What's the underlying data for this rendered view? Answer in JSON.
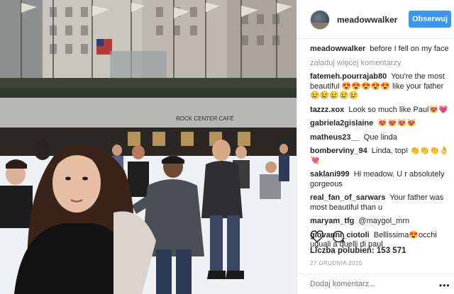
{
  "photo": {
    "sign_text": "ROCK CENTER CAFÉ"
  },
  "header": {
    "username": "meadowwalker",
    "follow_label": "Obserwuj"
  },
  "caption": {
    "author": "meadowwalker",
    "text": "before I fell on my face"
  },
  "load_more": "załaduj więcej komentarzy",
  "comments": [
    {
      "author": "fatemeh.pourrajab80",
      "text": "You're the most beautiful 😍😍😍😍😍 like your father 😢😢😢😢😢"
    },
    {
      "author": "tazzz.xox",
      "text": "Look so much like Paul😻💗"
    },
    {
      "author": "gabriela2gislaine",
      "text": "😻😻😻😻"
    },
    {
      "author": "matheus23__",
      "text": "Que linda"
    },
    {
      "author": "bomberviny_94",
      "text": "Linda, top! 👏👏👏👌💘"
    },
    {
      "author": "saklani999",
      "text": "Hi meadow. U r absolutely gorgeous"
    },
    {
      "author": "real_fan_of_sarwars",
      "text": "Your father was most beautiful than u"
    },
    {
      "author": "maryam_tfg",
      "text": "@maygol_mrn"
    },
    {
      "author": "giovanni_ciotoli",
      "text": "Bellissima😍occhi uguali a quelli di paul"
    }
  ],
  "likes": "Liczba polubień: 153 571",
  "date": "27 GRUDNIA 2015",
  "comment_placeholder": "Dodaj komentarz...",
  "icons": {
    "like": "heart-icon",
    "comment": "comment-icon",
    "more": "more-options-icon"
  },
  "colors": {
    "follow_button": "#3897f0",
    "muted_text": "#999999"
  }
}
